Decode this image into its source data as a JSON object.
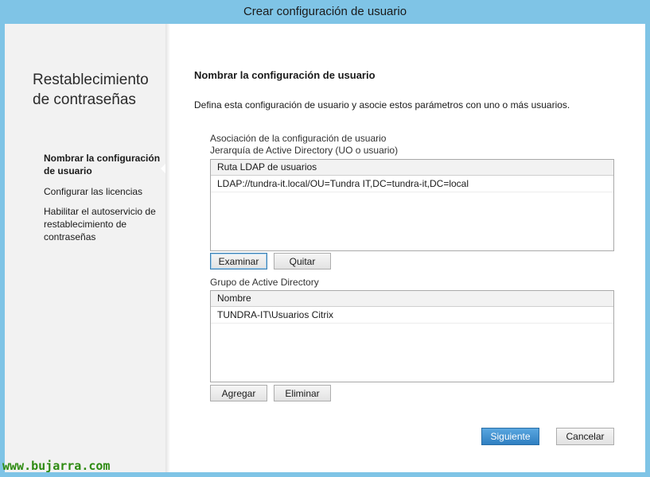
{
  "window": {
    "title": "Crear configuración de usuario"
  },
  "sidebar": {
    "title": "Restablecimiento de contraseñas",
    "items": [
      {
        "label": "Nombrar la configuración de usuario",
        "active": true
      },
      {
        "label": "Configurar las licencias",
        "active": false
      },
      {
        "label": "Habilitar el autoservicio de restablecimiento de contraseñas",
        "active": false
      }
    ]
  },
  "main": {
    "title": "Nombrar la configuración de usuario",
    "description": "Defina esta configuración de usuario y asocie estos parámetros con uno o más usuarios.",
    "association_label": "Asociación de la configuración de usuario",
    "hierarchy_label": "Jerarquía de Active Directory (UO o usuario)",
    "ldap_list": {
      "header": "Ruta LDAP de usuarios",
      "rows": [
        "LDAP://tundra-it.local/OU=Tundra IT,DC=tundra-it,DC=local"
      ]
    },
    "browse_label": "Examinar",
    "remove_label": "Quitar",
    "group_label": "Grupo de Active Directory",
    "group_list": {
      "header": "Nombre",
      "rows": [
        "TUNDRA-IT\\Usuarios Citrix"
      ]
    },
    "add_label": "Agregar",
    "delete_label": "Eliminar"
  },
  "footer": {
    "next_label": "Siguiente",
    "cancel_label": "Cancelar"
  },
  "watermark": "www.bujarra.com",
  "colors": {
    "titlebar": "#7fc4e6",
    "primary_button": "#2f7fc1"
  }
}
